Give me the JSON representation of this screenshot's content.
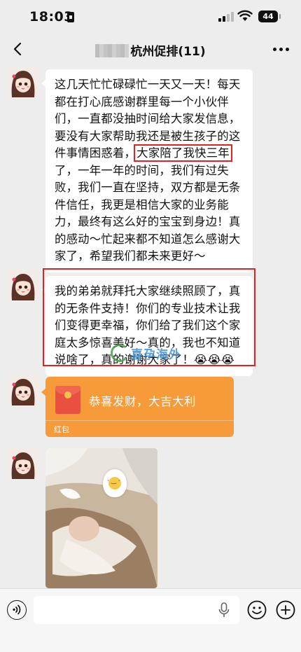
{
  "status": {
    "time": "18:03",
    "battery": "44"
  },
  "header": {
    "title": "杭州促排(11)"
  },
  "messages": {
    "msg1": {
      "part1": "这几天忙忙碌碌忙一天又一天！每天都在打心底感谢群里每一个小伙伴们，一直都没抽时间给大家发信息，要没有大家帮助我还是被生孩子的这件事情困惑着，",
      "highlight": "大家陪了我快三年",
      "part2": "了，一年一年的时间，我们有过失败，我们一直在坚持，双方都是无条件信任，我更是相信大家的业务能力，最终有这么好的宝宝到身边！真的感动～忙起来都不知道怎么感谢大家了，希望我们都未来更好～"
    },
    "msg2": {
      "text": "我的弟弟就拜托大家继续照顾了，真的无条件支持！你们的专业技术让我们变得更幸福，你们给了我们这个家庭太多惊喜美好～真的，我也不知道说啥了，真的谢谢大家了！😭😭😭"
    },
    "red_packet": {
      "greeting": "恭喜发财，大吉大利",
      "label": "红包"
    }
  },
  "watermark": {
    "text": "喜孕海外"
  },
  "input": {
    "placeholder": ""
  },
  "colors": {
    "background": "#ededed",
    "highlight_border": "#e12222",
    "red_packet": "#f79b3a"
  }
}
